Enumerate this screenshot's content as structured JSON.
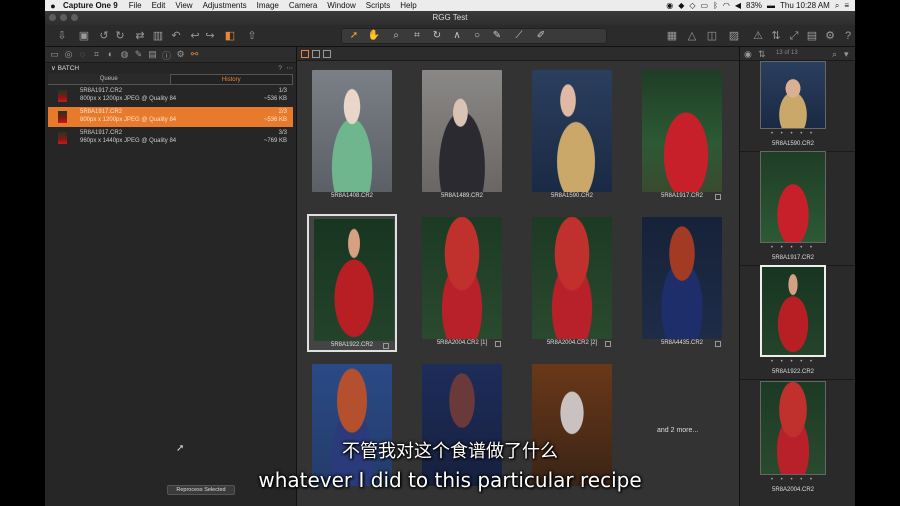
{
  "menubar": {
    "app_name": "Capture One 9",
    "menus": [
      "File",
      "Edit",
      "View",
      "Adjustments",
      "Image",
      "Camera",
      "Window",
      "Scripts",
      "Help"
    ],
    "battery": "83%",
    "clock": "Thu 10:28 AM"
  },
  "window": {
    "title": "RGG Test"
  },
  "batch": {
    "header": "BATCH",
    "tabs": [
      "Queue",
      "History"
    ],
    "active_tab": "History",
    "items": [
      {
        "name": "5R8A1917.CR2",
        "detail": "800px x 1200px JPEG @ Quality 84",
        "count": "1/3",
        "size": "~536 KB"
      },
      {
        "name": "5R8A1917.CR2",
        "detail": "800px x 1200px JPEG @ Quality 84",
        "count": "2/3",
        "size": "~536 KB"
      },
      {
        "name": "5R8A1917.CR2",
        "detail": "960px x 1440px JPEG @ Quality 84",
        "count": "3/3",
        "size": "~769 KB"
      }
    ],
    "reprocess_label": "Reprocess Selected"
  },
  "browser": {
    "cells": [
      {
        "label": "5R8A1408.CR2"
      },
      {
        "label": "5R8A1489.CR2"
      },
      {
        "label": "5R8A1590.CR2"
      },
      {
        "label": "5R8A1917.CR2"
      },
      {
        "label": "5R8A1922.CR2"
      },
      {
        "label": "5R8A2004.CR2 [1]"
      },
      {
        "label": "5R8A2004.CR2 [2]"
      },
      {
        "label": "5R8A4435.CR2"
      }
    ],
    "more_label": "and 2 more..."
  },
  "filmstrip": {
    "counter": "13 of 13",
    "labels": [
      "5R8A1590.CR2",
      "5R8A1917.CR2",
      "5R8A1922.CR2",
      "5R8A2004.CR2"
    ]
  },
  "subtitles": {
    "zh": "不管我对这个食谱做了什么",
    "en": "whatever I did to this particular recipe"
  }
}
